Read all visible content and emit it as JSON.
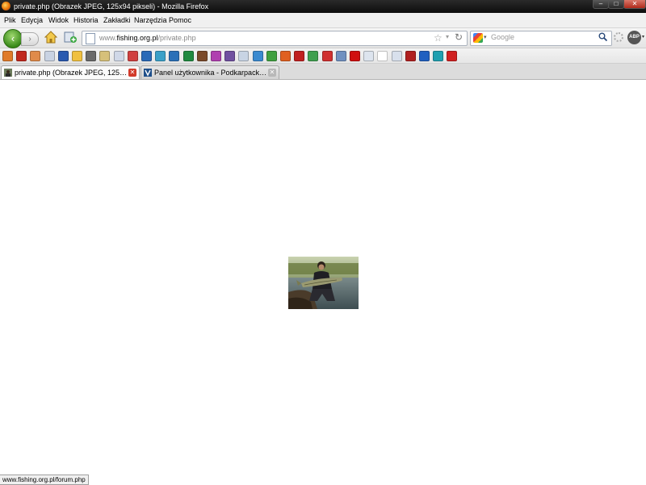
{
  "window": {
    "title": "private.php (Obrazek JPEG, 125x94 pikseli) - Mozilla Firefox",
    "controls": {
      "minimize": "–",
      "maximize": "□",
      "close": "✕"
    }
  },
  "menu": [
    "Plik",
    "Edycja",
    "Widok",
    "Historia",
    "Zakładki",
    "Narzędzia",
    "Pomoc"
  ],
  "nav": {
    "back": "‹",
    "forward": "›",
    "url_domain_prefix": "www.",
    "url_domain": "fishing.org.pl",
    "url_path": "/private.php",
    "star": "☆",
    "dropdown": "▾",
    "reload": "↻",
    "search_placeholder": "Google",
    "search_icon": "🔍",
    "abp": "ABP"
  },
  "bookmark_icons": [
    {
      "name": "home-bookmark-icon",
      "color": "#e07b2a"
    },
    {
      "name": "acrobat-icon",
      "color": "#c0281e"
    },
    {
      "name": "house-icon",
      "color": "#e08b4a"
    },
    {
      "name": "page-icon",
      "color": "#c9d3e3"
    },
    {
      "name": "script-icon",
      "color": "#2a5ab0"
    },
    {
      "name": "weather-icon",
      "color": "#f0c040"
    },
    {
      "name": "pen-icon",
      "color": "#6a6a6a"
    },
    {
      "name": "tool-icon",
      "color": "#d6c07a"
    },
    {
      "name": "doc-icon",
      "color": "#d0d8e8"
    },
    {
      "name": "flag-icon",
      "color": "#d04040"
    },
    {
      "name": "checkmark-v-icon",
      "color": "#2a6ab8"
    },
    {
      "name": "globe-icon",
      "color": "#3aa0c8"
    },
    {
      "name": "blue-circle-icon",
      "color": "#2a70b8"
    },
    {
      "name": "green-box-icon",
      "color": "#208a40"
    },
    {
      "name": "brown-circle-icon",
      "color": "#7a4a2a"
    },
    {
      "name": "m-letter-icon",
      "color": "#b040b0"
    },
    {
      "name": "purple-icon",
      "color": "#7050a0"
    },
    {
      "name": "page2-icon",
      "color": "#c8d4e4"
    },
    {
      "name": "puzzle-icon",
      "color": "#3a8ad0"
    },
    {
      "name": "shield-green-icon",
      "color": "#40a040"
    },
    {
      "name": "orange-icon",
      "color": "#e06020"
    },
    {
      "name": "red-square-icon",
      "color": "#c02020"
    },
    {
      "name": "leaf-icon",
      "color": "#40a050"
    },
    {
      "name": "target-icon",
      "color": "#d03030"
    },
    {
      "name": "swirl-icon",
      "color": "#7090c0"
    },
    {
      "name": "youtube-icon",
      "color": "#d01010"
    },
    {
      "name": "blank-page-icon",
      "color": "#dde4ee"
    },
    {
      "name": "white-page-icon",
      "color": "#ffffff"
    },
    {
      "name": "doc3-icon",
      "color": "#d8e0ec"
    },
    {
      "name": "picture-icon",
      "color": "#b02020"
    },
    {
      "name": "ukraine-flag-icon",
      "color": "#2060c0"
    },
    {
      "name": "arrows-icon",
      "color": "#20a0b0"
    },
    {
      "name": "x-icon",
      "color": "#d02020"
    }
  ],
  "tabs": [
    {
      "label": "private.php (Obrazek JPEG, 125x94 piks...",
      "close": "✕"
    },
    {
      "label": "Panel użytkownika - Podkarpacki Serwis ...",
      "close": "✕"
    }
  ],
  "content": {
    "image_alt": "Wędkarz z rybą (zdjęcie JPEG)"
  },
  "status": {
    "text": "www.fishing.org.pl/forum.php"
  }
}
